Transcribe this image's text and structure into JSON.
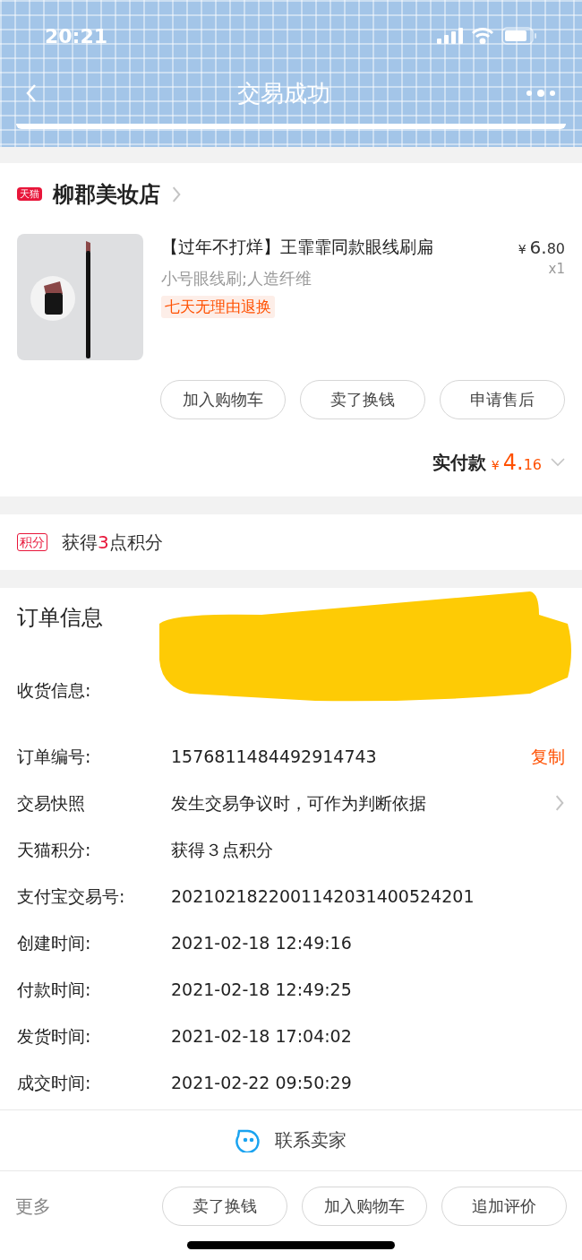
{
  "status_bar": {
    "time": "20:21"
  },
  "nav": {
    "title": "交易成功"
  },
  "store": {
    "name": "柳郡美妆店",
    "badge": "天猫"
  },
  "product": {
    "title": "【过年不打烊】王霏霏同款眼线刷扁",
    "sku": "小号眼线刷;人造纤维",
    "tag": "七天无理由退换",
    "price": {
      "currency": "¥",
      "integer": "6.",
      "decimal": "80"
    },
    "quantity": "x1",
    "actions": [
      "加入购物车",
      "卖了换钱",
      "申请售后"
    ]
  },
  "total": {
    "label": "实付款",
    "currency": "¥",
    "integer": "4.",
    "decimal": "16"
  },
  "points": {
    "badge": "积分",
    "before": "获得",
    "count": "3",
    "after": "点积分"
  },
  "order_info": {
    "title": "订单信息",
    "rows": [
      {
        "label": "收货信息:",
        "kind": "redacted"
      },
      {
        "label": "订单编号:",
        "value": "1576811484492914743",
        "kind": "copy",
        "action": "复制"
      },
      {
        "label": "交易快照",
        "value": "发生交易争议时，可作为判断依据",
        "kind": "link"
      },
      {
        "label": "天猫积分:",
        "value": "获得３点积分",
        "kind": "plain"
      },
      {
        "label": "支付宝交易号:",
        "value": "2021021822001142031400524201",
        "kind": "plain"
      },
      {
        "label": "创建时间:",
        "value": "2021-02-18 12:49:16",
        "kind": "plain"
      },
      {
        "label": "付款时间:",
        "value": "2021-02-18 12:49:25",
        "kind": "plain"
      },
      {
        "label": "发货时间:",
        "value": "2021-02-18 17:04:02",
        "kind": "plain"
      },
      {
        "label": "成交时间:",
        "value": "2021-02-22 09:50:29",
        "kind": "plain"
      }
    ]
  },
  "contact": {
    "label": "联系卖家"
  },
  "bottom_bar": {
    "more": "更多",
    "buttons": [
      "卖了换钱",
      "加入购物车",
      "追加评价"
    ]
  }
}
